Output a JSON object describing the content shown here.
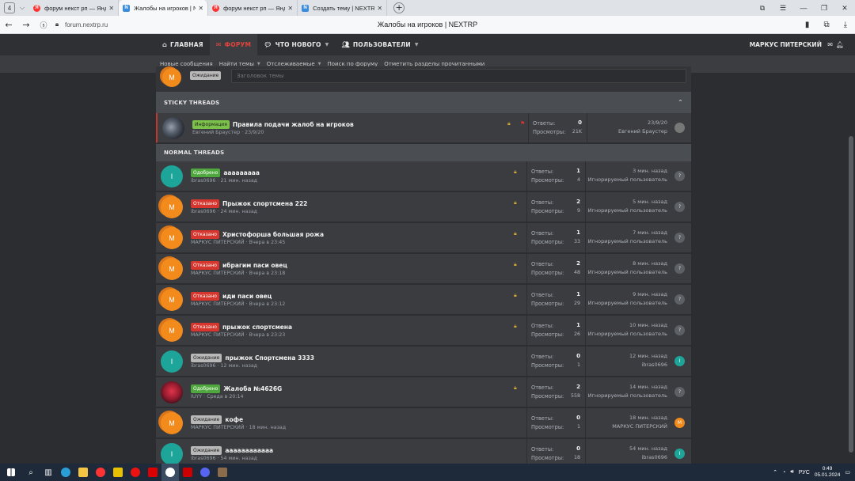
{
  "browser": {
    "tab_count": "4",
    "tabs": [
      {
        "label": "форум некст рп — Яндекс",
        "icon": "yandex-icon",
        "active": false
      },
      {
        "label": "Жалобы на игроков | N",
        "icon": "nextrp-icon",
        "active": true
      },
      {
        "label": "форум некст рп — Яндекс",
        "icon": "yandex-icon",
        "active": false
      },
      {
        "label": "Создать тему | NEXTRP",
        "icon": "nextrp-icon",
        "active": false
      }
    ],
    "url": "forum.nextrp.ru",
    "page_title": "Жалобы на игроков | NEXTRP"
  },
  "nav": {
    "main": [
      {
        "label": "ГЛАВНАЯ",
        "icon": "home-icon",
        "active": false,
        "caret": false
      },
      {
        "label": "ФОРУМ",
        "icon": "chat-icon",
        "active": true,
        "caret": false
      },
      {
        "label": "ЧТО НОВОГО",
        "icon": "comment-icon",
        "active": false,
        "caret": true
      },
      {
        "label": "ПОЛЬЗОВАТЕЛИ",
        "icon": "users-icon",
        "active": false,
        "caret": true
      }
    ],
    "username": "МАРКУС ПИТЕРСКИЙ",
    "sub": [
      {
        "label": "Новые сообщения",
        "caret": false
      },
      {
        "label": "Найти темы",
        "caret": true
      },
      {
        "label": "Отслеживаемые",
        "caret": true
      },
      {
        "label": "Поиск по форуму",
        "caret": false
      },
      {
        "label": "Отметить разделы прочитанными",
        "caret": false
      }
    ]
  },
  "compose": {
    "badge": "Ожидание",
    "placeholder": "Заголовок темы",
    "avatar_letter": "М"
  },
  "sections": {
    "sticky": "STICKY THREADS",
    "normal": "NORMAL THREADS"
  },
  "labels": {
    "replies": "Ответы:",
    "views": "Просмотры:"
  },
  "sticky_threads": [
    {
      "badge": "Информация",
      "badge_type": "info",
      "title": "Правила подачи жалоб на игроков",
      "author": "Евгений Браустер",
      "date": "23/9/20",
      "replies": "0",
      "views": "21K",
      "last_when": "23/9/20",
      "last_who": "Евгений Браустер",
      "avatar": "photo1",
      "letter": "",
      "last_avatar": "photo",
      "last_letter": "",
      "locked": true,
      "pinned": true
    }
  ],
  "threads": [
    {
      "badge": "Одобрено",
      "badge_type": "green",
      "title": "ааааааааа",
      "author": "ibras0696",
      "date": "21 мин. назад",
      "replies": "1",
      "views": "4",
      "last_when": "3 мин. назад",
      "last_who": "Игнорируемый пользователь",
      "avatar": "teal",
      "letter": "I",
      "last_avatar": "q",
      "last_letter": "?",
      "locked": true
    },
    {
      "badge": "Отказано",
      "badge_type": "red",
      "title": "Прыжок спортсмена 222",
      "author": "ibras0696",
      "date": "24 мин. назад",
      "replies": "2",
      "views": "9",
      "last_when": "5 мин. назад",
      "last_who": "Игнорируемый пользователь",
      "avatar": "orange",
      "letter": "М",
      "last_avatar": "q",
      "last_letter": "?",
      "locked": true
    },
    {
      "badge": "Отказано",
      "badge_type": "red",
      "title": "Христофорша большая рожа",
      "author": "МАРКУС ПИТЕРСКИЙ",
      "date": "Вчера в 23:45",
      "replies": "1",
      "views": "33",
      "last_when": "7 мин. назад",
      "last_who": "Игнорируемый пользователь",
      "avatar": "orange",
      "letter": "М",
      "last_avatar": "q",
      "last_letter": "?",
      "locked": true
    },
    {
      "badge": "Отказано",
      "badge_type": "red",
      "title": "ибрагим паси овец",
      "author": "МАРКУС ПИТЕРСКИЙ",
      "date": "Вчера в 23:18",
      "replies": "2",
      "views": "48",
      "last_when": "8 мин. назад",
      "last_who": "Игнорируемый пользователь",
      "avatar": "orange",
      "letter": "М",
      "last_avatar": "q",
      "last_letter": "?",
      "locked": true
    },
    {
      "badge": "Отказано",
      "badge_type": "red",
      "title": "иди паси овец",
      "author": "МАРКУС ПИТЕРСКИЙ",
      "date": "Вчера в 23:12",
      "replies": "1",
      "views": "29",
      "last_when": "9 мин. назад",
      "last_who": "Игнорируемый пользователь",
      "avatar": "orange",
      "letter": "М",
      "last_avatar": "q",
      "last_letter": "?",
      "locked": true
    },
    {
      "badge": "Отказано",
      "badge_type": "red",
      "title": "прыжок спортсмена",
      "author": "МАРКУС ПИТЕРСКИЙ",
      "date": "Вчера в 23:23",
      "replies": "1",
      "views": "26",
      "last_when": "10 мин. назад",
      "last_who": "Игнорируемый пользователь",
      "avatar": "orange",
      "letter": "М",
      "last_avatar": "q",
      "last_letter": "?",
      "locked": true
    },
    {
      "badge": "Ожидание",
      "badge_type": "gray",
      "title": "прыжок Спортсмена 3333",
      "author": "ibras0696",
      "date": "12 мин. назад",
      "replies": "0",
      "views": "1",
      "last_when": "12 мин. назад",
      "last_who": "ibras0696",
      "avatar": "teal",
      "letter": "I",
      "last_avatar": "teal",
      "last_letter": "I",
      "locked": false
    },
    {
      "badge": "Одобрено",
      "badge_type": "green",
      "title": "Жалоба №4626G",
      "author": "IUYY",
      "date": "Среда в 20:14",
      "replies": "2",
      "views": "558",
      "last_when": "14 мин. назад",
      "last_who": "Игнорируемый пользователь",
      "avatar": "photo2",
      "letter": "",
      "last_avatar": "q",
      "last_letter": "?",
      "locked": true
    },
    {
      "badge": "Ожидание",
      "badge_type": "gray",
      "title": "кофе",
      "author": "МАРКУС ПИТЕРСКИЙ",
      "date": "18 мин. назад",
      "replies": "0",
      "views": "1",
      "last_when": "18 мин. назад",
      "last_who": "МАРКУС ПИТЕРСКИЙ",
      "avatar": "orange",
      "letter": "М",
      "last_avatar": "orange",
      "last_letter": "М",
      "locked": false
    },
    {
      "badge": "Ожидание",
      "badge_type": "gray",
      "title": "аааааааааааа",
      "author": "ibras0696",
      "date": "54 мин. назад",
      "replies": "0",
      "views": "18",
      "last_when": "54 мин. назад",
      "last_who": "ibras0696",
      "avatar": "teal",
      "letter": "I",
      "last_avatar": "teal",
      "last_letter": "I",
      "locked": false
    }
  ],
  "taskbar": {
    "lang": "РУС",
    "time": "0:49",
    "date": "05.01.2024"
  }
}
